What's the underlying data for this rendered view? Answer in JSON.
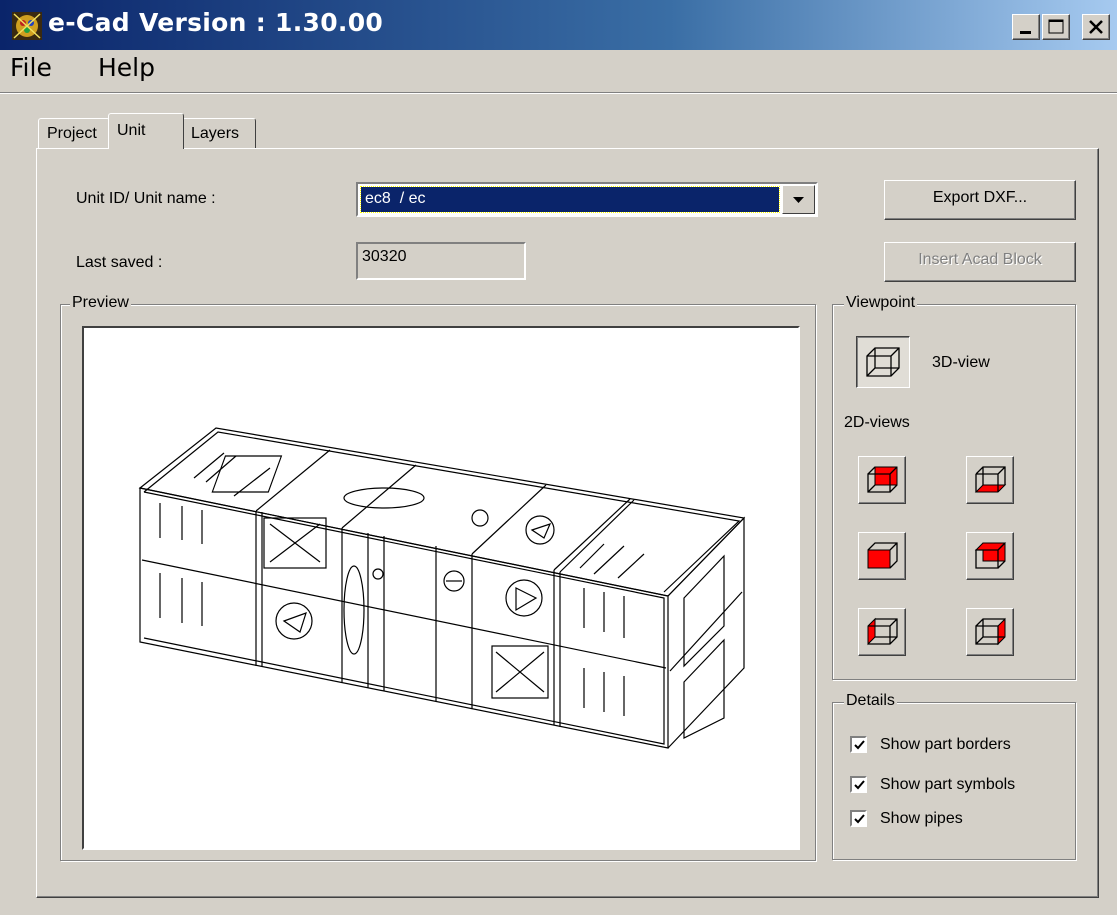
{
  "window": {
    "title": "e-Cad  Version : 1.30.00"
  },
  "menu": {
    "file": "File",
    "help": "Help"
  },
  "tabs": {
    "project": "Project",
    "unit": "Unit",
    "layers": "Layers"
  },
  "unit_form": {
    "unit_label": "Unit ID/ Unit name :",
    "unit_value": "ec8  / ec",
    "last_saved_label": "Last saved :",
    "last_saved_value": "30320",
    "export_dxf": "Export DXF...",
    "insert_acad": "Insert Acad Block"
  },
  "preview": {
    "title": "Preview"
  },
  "viewpoint": {
    "title": "Viewpoint",
    "view3d_label": "3D-view",
    "views2d_label": "2D-views"
  },
  "details": {
    "title": "Details",
    "show_borders": "Show part borders",
    "show_symbols": "Show part symbols",
    "show_pipes": "Show pipes",
    "borders_checked": true,
    "symbols_checked": true,
    "pipes_checked": true
  },
  "colors": {
    "title_start": "#0a246a",
    "title_end": "#a6caf0",
    "face_highlight": "#ff0000",
    "selection": "#0a246a"
  },
  "icons": [
    "app-icon",
    "minimize-icon",
    "maximize-icon",
    "close-icon",
    "dropdown-arrow-icon",
    "cube-icon",
    "checkmark-icon"
  ]
}
